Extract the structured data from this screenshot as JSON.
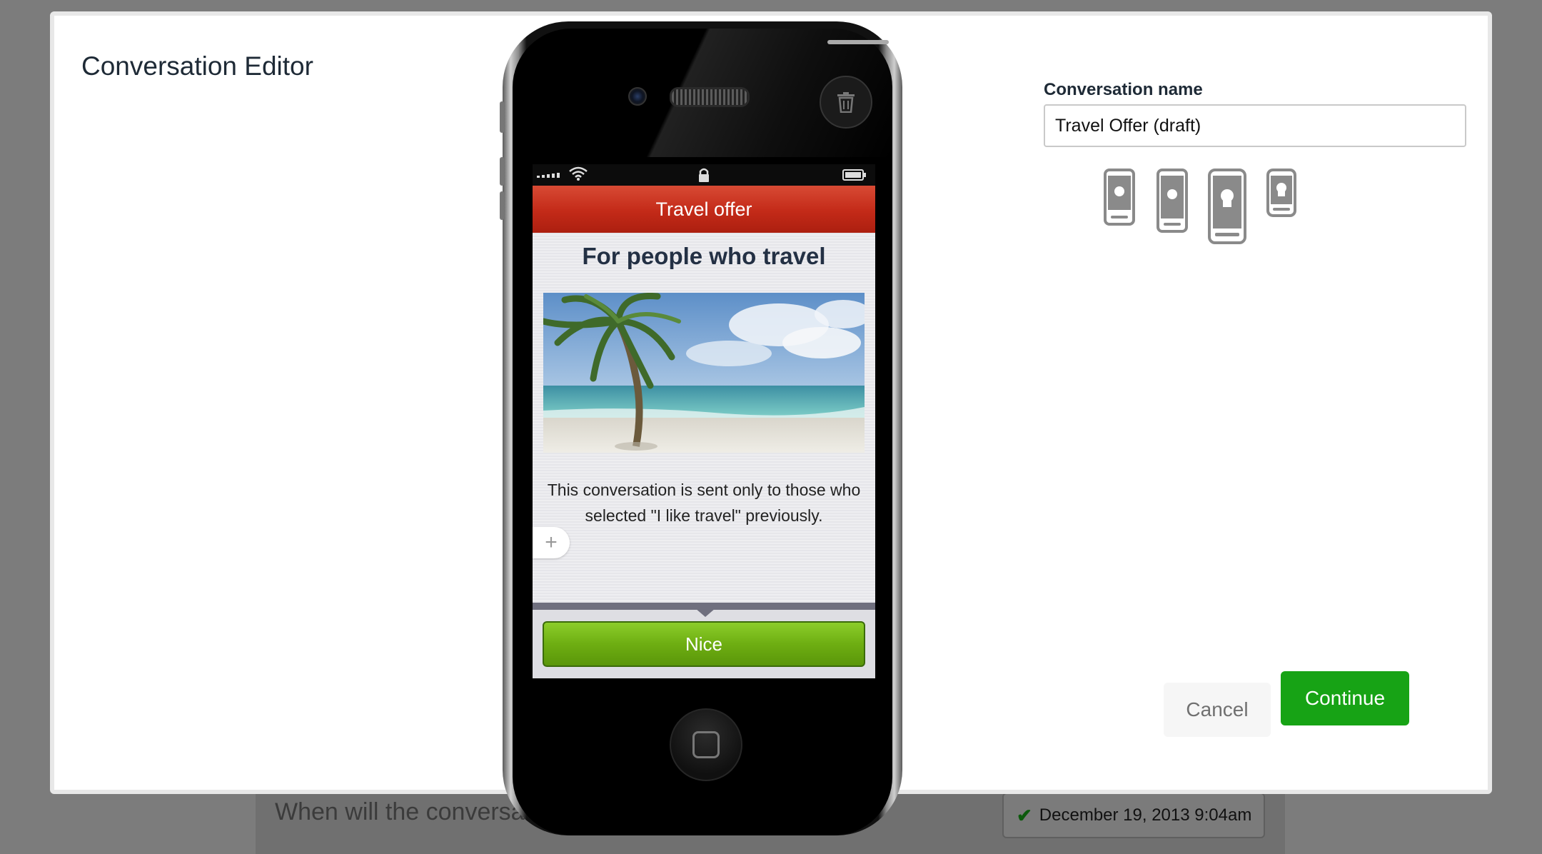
{
  "background": {
    "question": "When will the conversation finish?",
    "date_badge": "December 19, 2013 9:04am"
  },
  "modal": {
    "title": "Conversation Editor",
    "preview": {
      "nav_title": "Travel offer",
      "headline": "For people who travel",
      "description": "This conversation is sent only to those who selected \"I like travel\" previously.",
      "add_block": "+",
      "button_label": "Nice"
    },
    "form": {
      "name_label": "Conversation name",
      "name_value": "Travel Offer (draft)",
      "devices": [
        "iphone-4-icon",
        "iphone-5-icon",
        "android-phone-icon",
        "android-small-icon"
      ]
    },
    "actions": {
      "cancel": "Cancel",
      "continue": "Continue"
    }
  },
  "colors": {
    "accent_green": "#17a315",
    "nav_red": "#c32a18",
    "button_green": "#6eae12"
  }
}
